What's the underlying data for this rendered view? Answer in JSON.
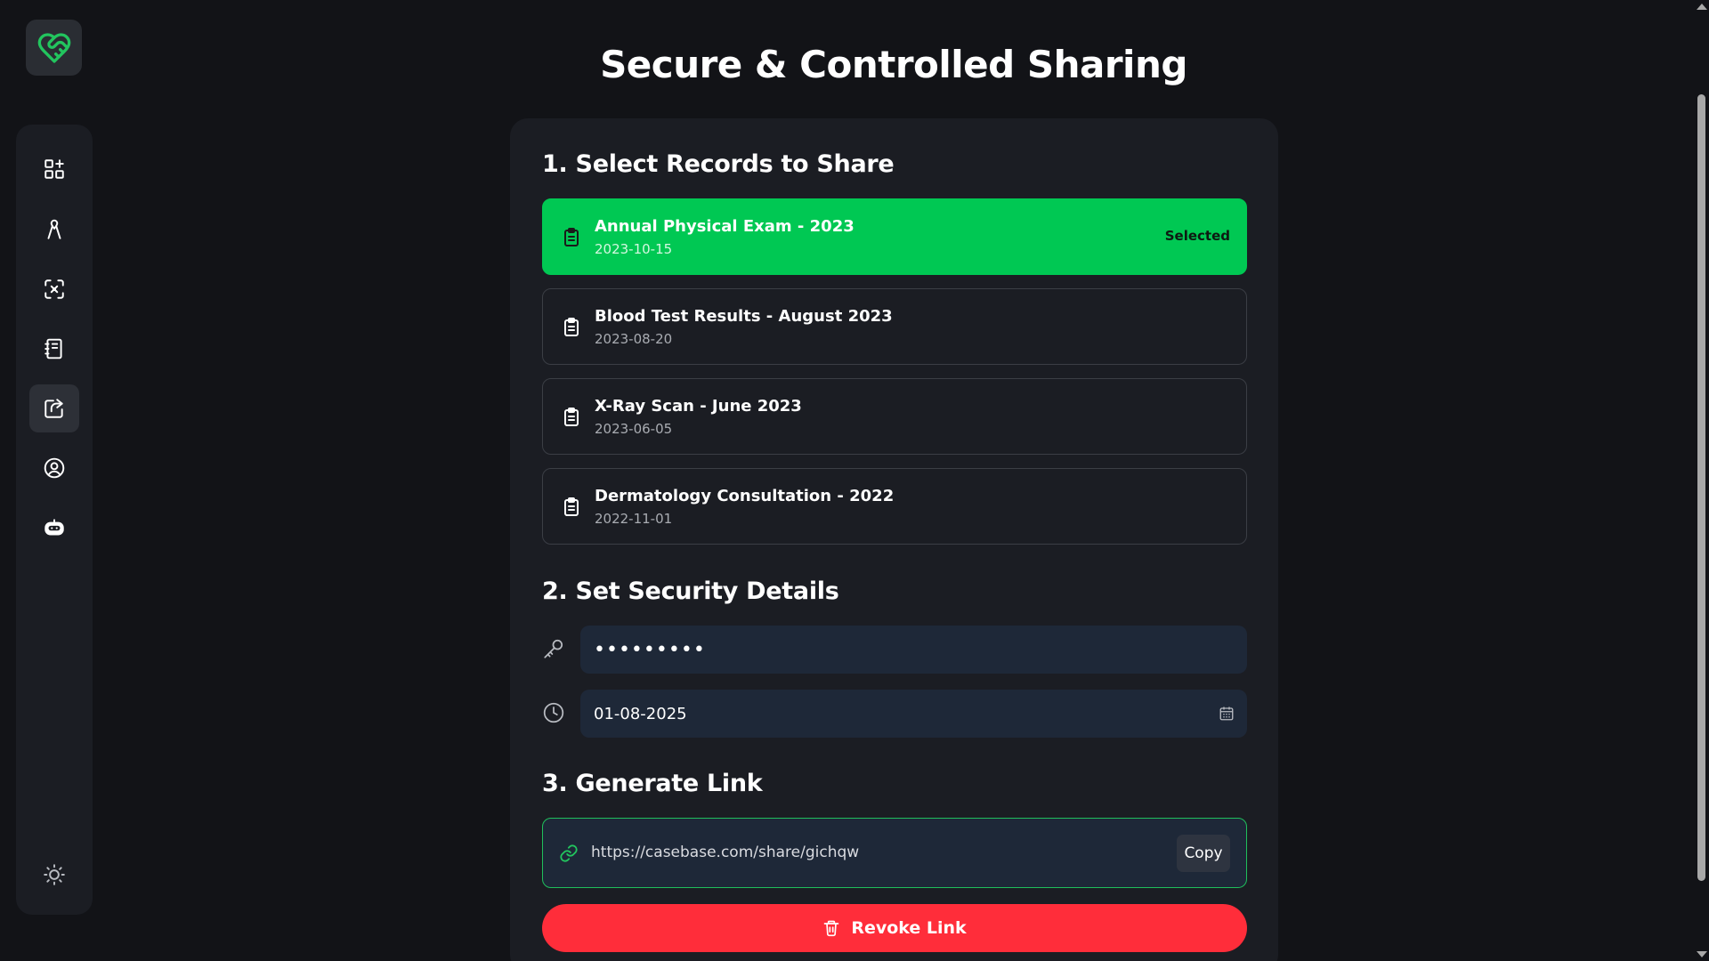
{
  "app": {
    "logo_icon": "heart-handshake-icon"
  },
  "sidebar": {
    "items": [
      {
        "icon": "dashboard-grid-icon"
      },
      {
        "icon": "ribbon-icon"
      },
      {
        "icon": "scan-focus-icon"
      },
      {
        "icon": "notebook-icon"
      },
      {
        "icon": "share-icon",
        "active": true
      },
      {
        "icon": "user-circle-icon"
      },
      {
        "icon": "robot-icon"
      }
    ],
    "theme_icon": "sun-icon"
  },
  "header": {
    "title": "Secure & Controlled Sharing"
  },
  "sections": {
    "select_records": "1. Select Records to Share",
    "security": "2. Set Security Details",
    "generate": "3. Generate Link"
  },
  "records": [
    {
      "name": "Annual Physical Exam - 2023",
      "date": "2023-10-15",
      "selected": true,
      "badge": "Selected"
    },
    {
      "name": "Blood Test Results - August 2023",
      "date": "2023-08-20",
      "selected": false
    },
    {
      "name": "X-Ray Scan - June 2023",
      "date": "2023-06-05",
      "selected": false
    },
    {
      "name": "Dermatology Consultation - 2022",
      "date": "2022-11-01",
      "selected": false
    }
  ],
  "security": {
    "password_value": "•••••••••",
    "expiry_date": "01-08-2025"
  },
  "link": {
    "url": "https://casebase.com/share/gichqw",
    "copy_label": "Copy"
  },
  "revoke_label": "Revoke Link",
  "colors": {
    "accent_green": "#00c853",
    "danger_red": "#ff2d3a",
    "background": "#121317",
    "card": "#1b1d23",
    "input_bg": "#1e2838"
  }
}
